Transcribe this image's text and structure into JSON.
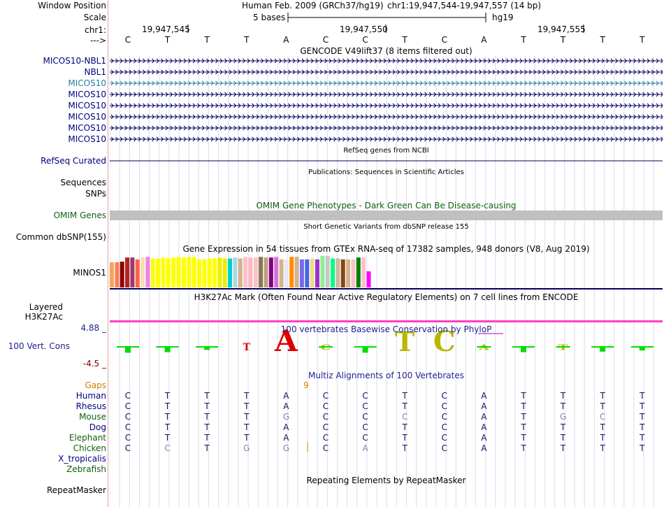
{
  "header": {
    "window_position_label": "Window Position",
    "scale_label": "Scale",
    "chrom_label": "chr1:",
    "arrow_label": "--->",
    "assembly": "Human Feb. 2009 (GRCh37/hg19)",
    "position": "chr1:19,947,544-19,947,557 (14 bp)",
    "scale_text": "5 bases",
    "db": "hg19",
    "coord_ticks": [
      "19,947,545",
      "19,947,550",
      "19,947,555"
    ],
    "bases": [
      "C",
      "T",
      "T",
      "T",
      "A",
      "C",
      "C",
      "T",
      "C",
      "A",
      "T",
      "T",
      "T",
      "T"
    ]
  },
  "tracks": {
    "gencode": {
      "title": "GENCODE V49lift37 (8 items filtered out)",
      "items": [
        "MICOS10-NBL1",
        "NBL1",
        "MICOS10",
        "MICOS10",
        "MICOS10",
        "MICOS10",
        "MICOS10",
        "MICOS10"
      ]
    },
    "refseq": {
      "title": "RefSeq genes from NCBI",
      "label": "RefSeq Curated"
    },
    "publications": {
      "title": "Publications: Sequences in Scientific Articles",
      "label": "Sequences",
      "label2": "SNPs"
    },
    "omim": {
      "title": "OMIM Gene Phenotypes - Dark Green Can Be Disease-causing",
      "label": "OMIM Genes"
    },
    "dbsnp": {
      "title": "Short Genetic Variants from dbSNP release 155",
      "label": "Common dbSNP(155)"
    },
    "gtex": {
      "title": "Gene Expression in 54 tissues from GTEx RNA-seq of 17382 samples, 948 donors (V8, Aug 2019)",
      "label": "MINOS1",
      "bar_colors": [
        "#f4a460",
        "#ff7f50",
        "#8b0000",
        "#b22222",
        "#9b3b6b",
        "#ff6347",
        "#f5deb3",
        "#ee82ee",
        "#ffff00",
        "#ffff00",
        "#ffff00",
        "#ffff00",
        "#ffff00",
        "#ffff00",
        "#ffff00",
        "#ffff00",
        "#ffff00",
        "#ffff00",
        "#ffff00",
        "#ffff00",
        "#ffff00",
        "#eeee00",
        "#eeee00",
        "#00ced1",
        "#add8e6",
        "#d2b48c",
        "#ffc0cb",
        "#ffb6c1",
        "#f5c6c6",
        "#8b7355",
        "#c0a080",
        "#800080",
        "#da70d6",
        "#d2b48c",
        "#e6e6fa",
        "#ff8c00",
        "#d2b48c",
        "#7b68ee",
        "#4169e1",
        "#eedc82",
        "#9932cc",
        "#90ee90",
        "#c8c8c8",
        "#00ff7f",
        "#cdb79e",
        "#8b4513",
        "#d2b48c",
        "#ffc0cb",
        "#008000",
        "#ffc0cb",
        "#ff00ff"
      ],
      "bar_values": [
        0.78,
        0.78,
        0.8,
        0.93,
        0.93,
        0.87,
        0.93,
        0.95,
        0.9,
        0.9,
        0.93,
        0.9,
        0.93,
        0.95,
        0.93,
        0.95,
        0.95,
        0.87,
        0.87,
        0.9,
        0.9,
        0.93,
        0.9,
        0.9,
        0.93,
        0.9,
        0.95,
        0.93,
        0.93,
        0.95,
        0.93,
        0.93,
        0.95,
        0.87,
        0.87,
        0.95,
        0.95,
        0.87,
        0.87,
        0.9,
        0.87,
        0.98,
        0.98,
        0.9,
        0.9,
        0.87,
        0.87,
        0.87,
        0.93,
        0.93,
        0.5
      ]
    },
    "h3k27ac": {
      "title": "H3K27Ac Mark (Often Found Near Active Regulatory Elements) on 7 cell lines from ENCODE",
      "label": "Layered H3K27Ac"
    },
    "cons": {
      "title": "100 vertebrates Basewise Conservation by PhyloP",
      "label": "100 Vert. Cons",
      "max": "4.88 _",
      "min": "-4.5 _",
      "scores": [
        0.4,
        0.35,
        0.15,
        -0.45,
        1.2,
        0.5,
        0.4,
        1.0,
        1.1,
        0.5,
        0.35,
        0.5,
        0.3,
        0.2
      ]
    },
    "multiz": {
      "title": "Multiz Alignments of 100 Vertebrates",
      "gaps_label": "Gaps",
      "gap_count": "9",
      "species": [
        {
          "name": "Human",
          "bases": [
            "C",
            "T",
            "T",
            "T",
            "A",
            "C",
            "C",
            "T",
            "C",
            "A",
            "T",
            "T",
            "T",
            "T"
          ]
        },
        {
          "name": "Rhesus",
          "bases": [
            "C",
            "T",
            "T",
            "T",
            "A",
            "C",
            "C",
            "T",
            "C",
            "A",
            "T",
            "T",
            "T",
            "T"
          ]
        },
        {
          "name": "Mouse",
          "bases": [
            "C",
            "T",
            "T",
            "T",
            "G",
            "C",
            "C",
            "C",
            "C",
            "A",
            "T",
            "G",
            "C",
            "T"
          ]
        },
        {
          "name": "Dog",
          "bases": [
            "C",
            "T",
            "T",
            "T",
            "A",
            "C",
            "C",
            "T",
            "C",
            "A",
            "T",
            "T",
            "T",
            "T"
          ]
        },
        {
          "name": "Elephant",
          "bases": [
            "C",
            "T",
            "T",
            "T",
            "A",
            "C",
            "C",
            "T",
            "C",
            "A",
            "T",
            "T",
            "T",
            "T"
          ]
        },
        {
          "name": "Chicken",
          "bases": [
            "C",
            "C",
            "T",
            "G",
            "G",
            "C",
            "A",
            "T",
            "C",
            "A",
            "T",
            "T",
            "T",
            "T"
          ]
        },
        {
          "name": "X_tropicalis",
          "bases": []
        },
        {
          "name": "Zebrafish",
          "bases": []
        }
      ]
    },
    "repeatmasker": {
      "title": "Repeating Elements by RepeatMasker",
      "label": "RepeatMasker"
    }
  },
  "colors": {
    "navy": "#1f1f8f",
    "green": "#106010",
    "omim_bar": "#c0c0c0",
    "pink_line": "#ff40c0",
    "cons_green": "#00dd00"
  }
}
